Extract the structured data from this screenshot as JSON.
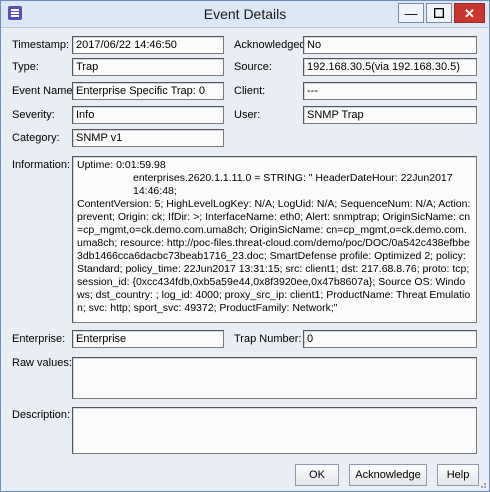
{
  "window": {
    "title": "Event Details"
  },
  "fields": {
    "timestamp": {
      "label": "Timestamp:",
      "value": "2017/06/22 14:46:50"
    },
    "type": {
      "label": "Type:",
      "value": "Trap"
    },
    "event_name": {
      "label": "Event Name:",
      "value": "Enterprise Specific Trap: 0"
    },
    "severity": {
      "label": "Severity:",
      "value": "Info"
    },
    "category": {
      "label": "Category:",
      "value": "SNMP v1"
    },
    "acknowledged": {
      "label": "Acknowledged:",
      "value": "No"
    },
    "source": {
      "label": "Source:",
      "value": "192.168.30.5(via 192.168.30.5)"
    },
    "client": {
      "label": "Client:",
      "value": "---"
    },
    "user": {
      "label": "User:",
      "value": "SNMP Trap"
    },
    "enterprise": {
      "label": "Enterprise:",
      "value": "Enterprise"
    },
    "trap_number": {
      "label": "Trap Number:",
      "value": "0"
    },
    "raw_values": {
      "label": "Raw values:",
      "value": ""
    },
    "description": {
      "label": "Description:",
      "value": ""
    }
  },
  "information": {
    "label": "Information:",
    "lines": [
      "Uptime: 0:01:59.98",
      "enterprises.2620.1.1.11.0 = STRING: \" HeaderDateHour: 22Jun2017 14:46:48;",
      "ContentVersion: 5; HighLevelLogKey: N/A; LogUid: N/A; SequenceNum: N/A; Action: prevent; Origin: ck; IfDir: >; InterfaceName: eth0; Alert: snmptrap; OriginSicName: cn=cp_mgmt,o=ck.demo.com.uma8ch; OriginSicName: cn=cp_mgmt,o=ck.demo.com.uma8ch; resource: http://poc-files.threat-cloud.com/demo/poc/DOC/0a542c438efbbe3db1466cca6dacbc73beab1716_23.doc; SmartDefense profile: Optimized 2; policy: Standard; policy_time: 22Jun2017 13:31:15; src: client1; dst: 217.68.8.76; proto: tcp; session_id: {0xcc434fdb,0xb5a59e44,0x8f3920ee,0x47b8607a}; Source OS: Windows; dst_country: ; log_id: 4000; proxy_src_ip: client1; ProductName: Threat Emulation; svc: http; sport_svc: 49372; ProductFamily: Network;\""
    ]
  },
  "buttons": {
    "ok": "OK",
    "acknowledge": "Acknowledge",
    "help": "Help"
  },
  "icons": {
    "app": "event-log-icon",
    "minimize": "minimize-icon",
    "maximize": "maximize-icon",
    "close": "close-icon"
  },
  "colors": {
    "title_bar": "#dbe7f5",
    "close_button": "#c7372f",
    "background": "#e9eef5"
  }
}
